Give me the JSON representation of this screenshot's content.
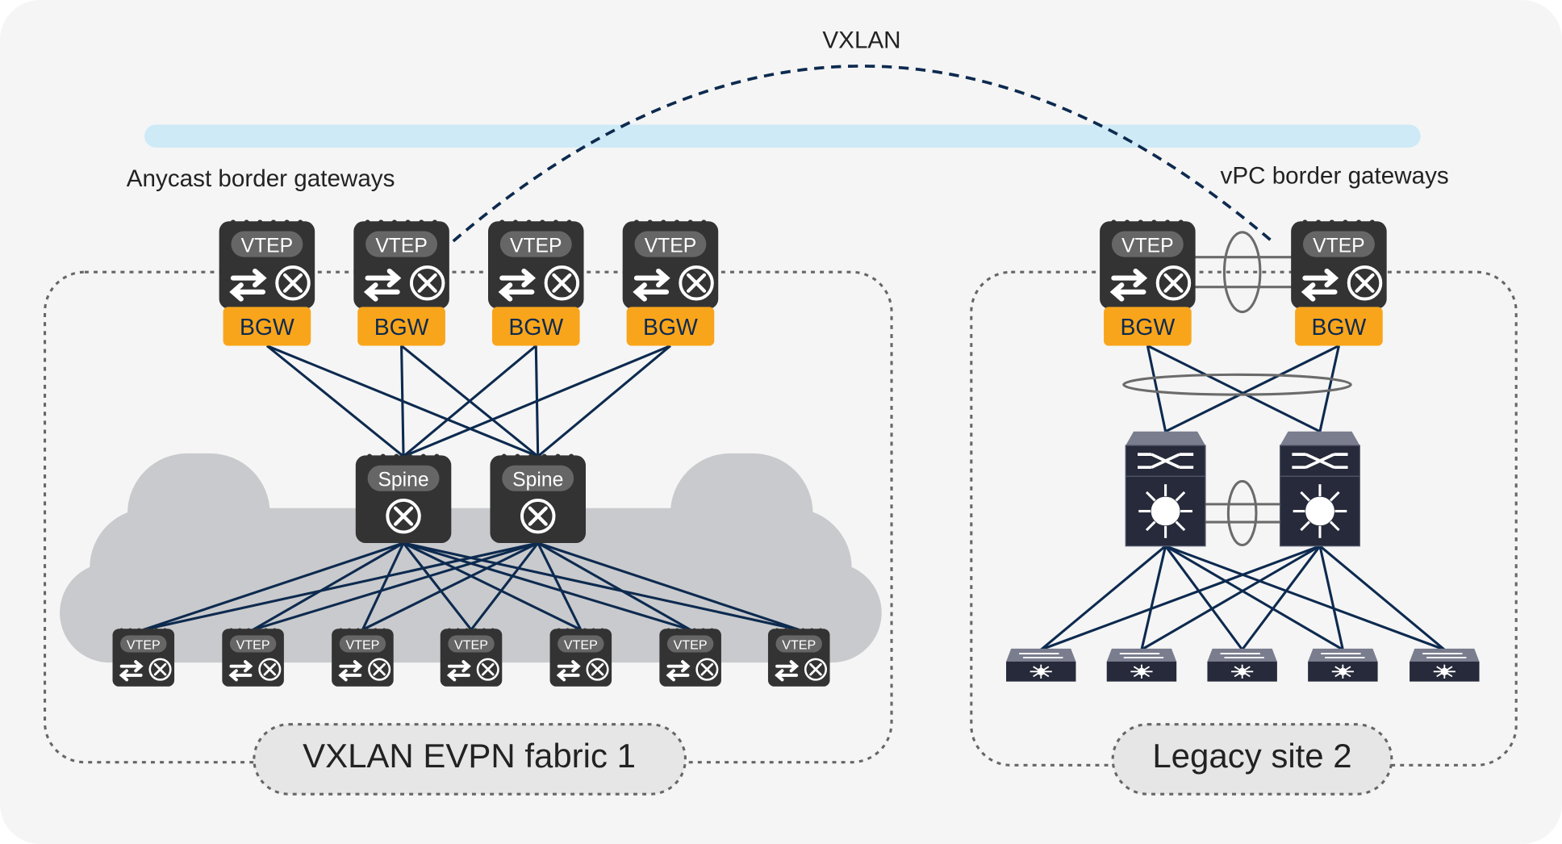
{
  "tunnel_label": "VXLAN",
  "anycast_title": "Anycast border gateways",
  "vpc_title": "vPC border gateways",
  "fabric1_label": "VXLAN EVPN fabric 1",
  "site2_label": "Legacy site 2",
  "vtep_label": "VTEP",
  "bgw_label": "BGW",
  "spine_label": "Spine",
  "colors": {
    "link": "#0d2a4f",
    "bgw": "#f9a51b",
    "device": "#333333",
    "pill": "#666666",
    "overlay_bar": "#cdeaf6",
    "cloud": "#c9cacd"
  },
  "icons": [
    "arrows-exchange-icon",
    "router-icon",
    "layer3-switch-icon",
    "access-switch-icon"
  ],
  "fabric1": {
    "bgw_count": 4,
    "spine_count": 2,
    "leaf_count": 7
  },
  "site2": {
    "bgw_count": 2,
    "distribution_count": 2,
    "access_count": 5
  }
}
